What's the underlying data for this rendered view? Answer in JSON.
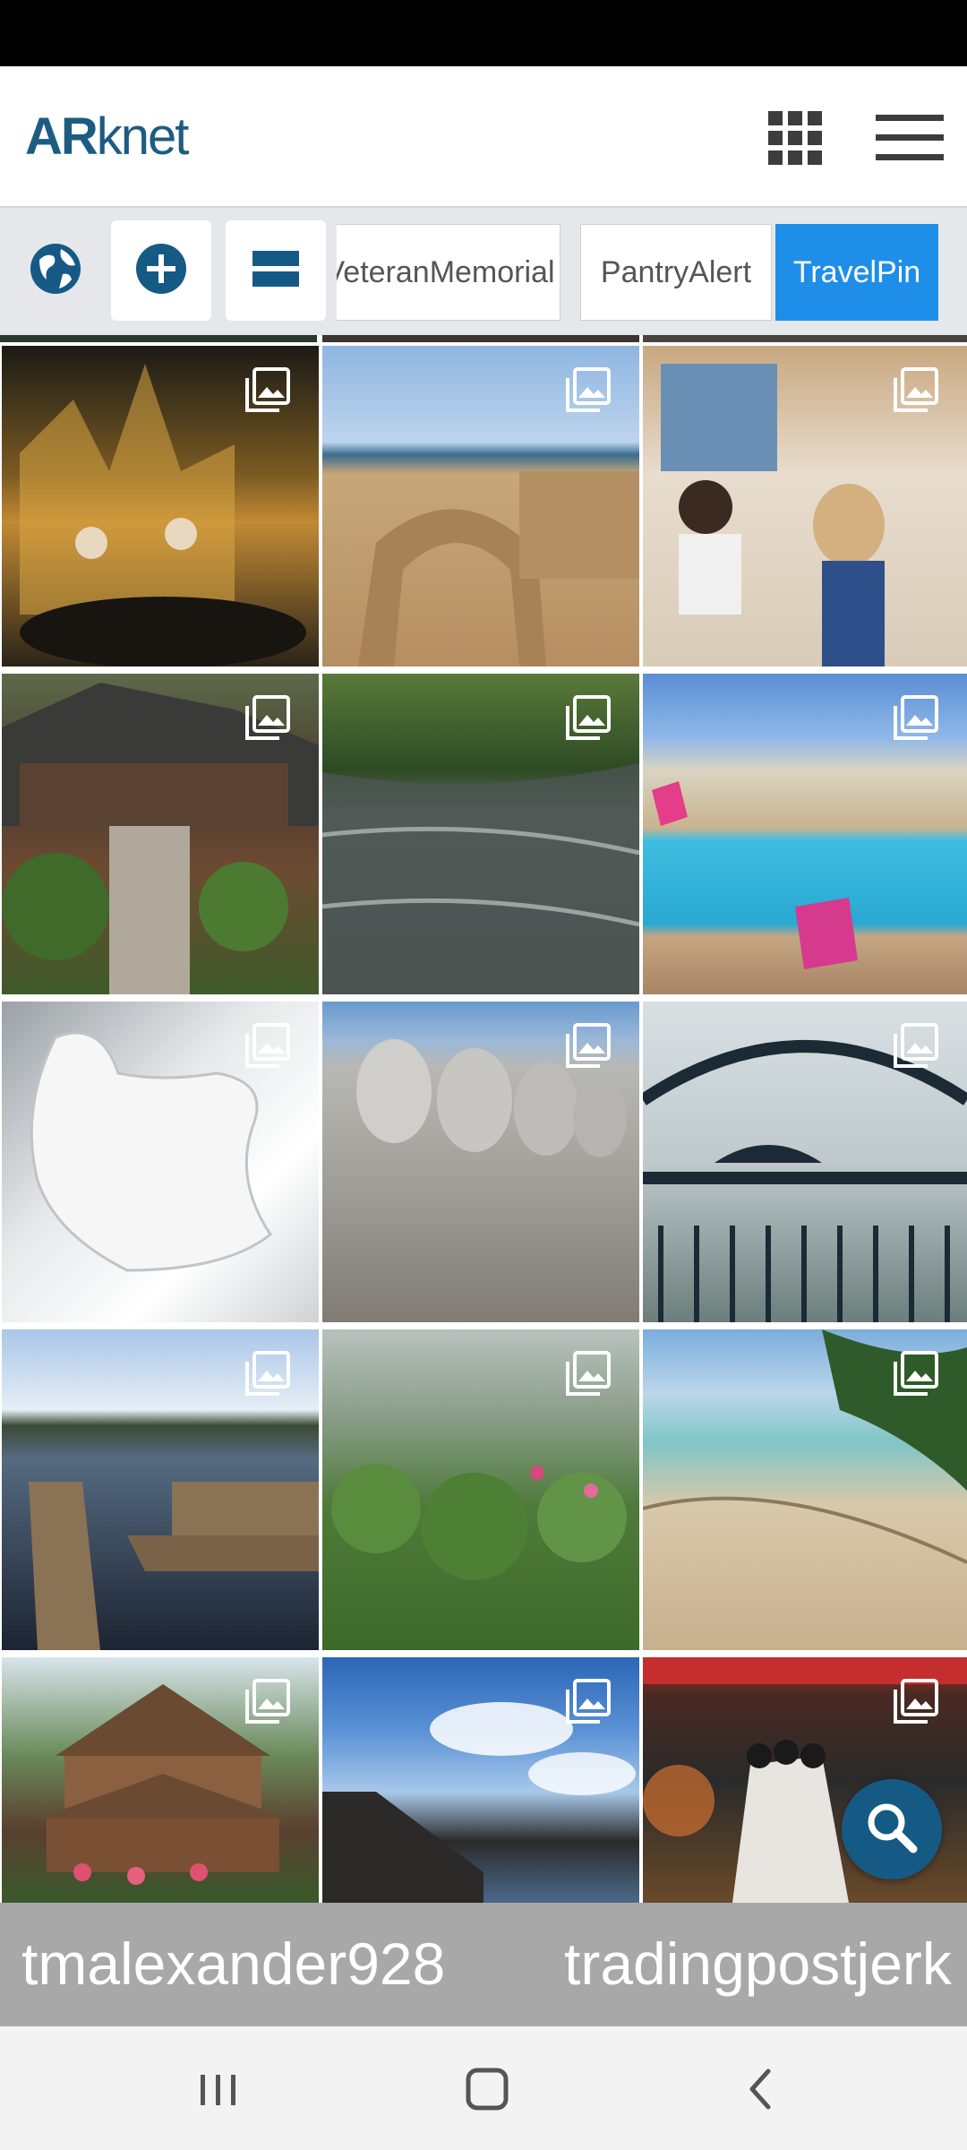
{
  "header": {
    "logo_bold": "AR",
    "logo_rest": "knet",
    "apps_icon": "grid-apps-icon",
    "menu_icon": "hamburger-menu-icon"
  },
  "toolbar": {
    "globe_icon": "globe-icon",
    "add_icon": "add-circle-icon",
    "view_icon": "view-toggle-icon",
    "tabs": [
      {
        "label": "VeteranMemorial",
        "active": false
      },
      {
        "label": "PantryAlert",
        "active": false
      },
      {
        "label": "TravelPin",
        "active": true
      }
    ]
  },
  "colors": {
    "brand": "#1d5c82",
    "active_tab": "#1f8ee9",
    "fab": "#155a85",
    "user_strip": "#a8a8a8"
  },
  "grid": {
    "tiles": [
      {
        "subject": "cathedral at night, carriage ride"
      },
      {
        "subject": "stone arch ruins by the sea"
      },
      {
        "subject": "bakery counter"
      },
      {
        "subject": "log cabin with stone steps"
      },
      {
        "subject": "forest river"
      },
      {
        "subject": "pool with pink chairs"
      },
      {
        "subject": "white horse sculpture"
      },
      {
        "subject": "mount rushmore"
      },
      {
        "subject": "cemetery gate"
      },
      {
        "subject": "lake dock"
      },
      {
        "subject": "misty garden"
      },
      {
        "subject": "tropical beach"
      },
      {
        "subject": "pagoda restaurant"
      },
      {
        "subject": "sky and cliffs"
      },
      {
        "subject": "dragster"
      }
    ]
  },
  "search_fab_icon": "search-icon",
  "users": [
    "tmalexander928",
    "tradingpostjerk"
  ],
  "navigation": {
    "recents_icon": "recents-icon",
    "home_icon": "home-icon",
    "back_icon": "back-icon"
  }
}
